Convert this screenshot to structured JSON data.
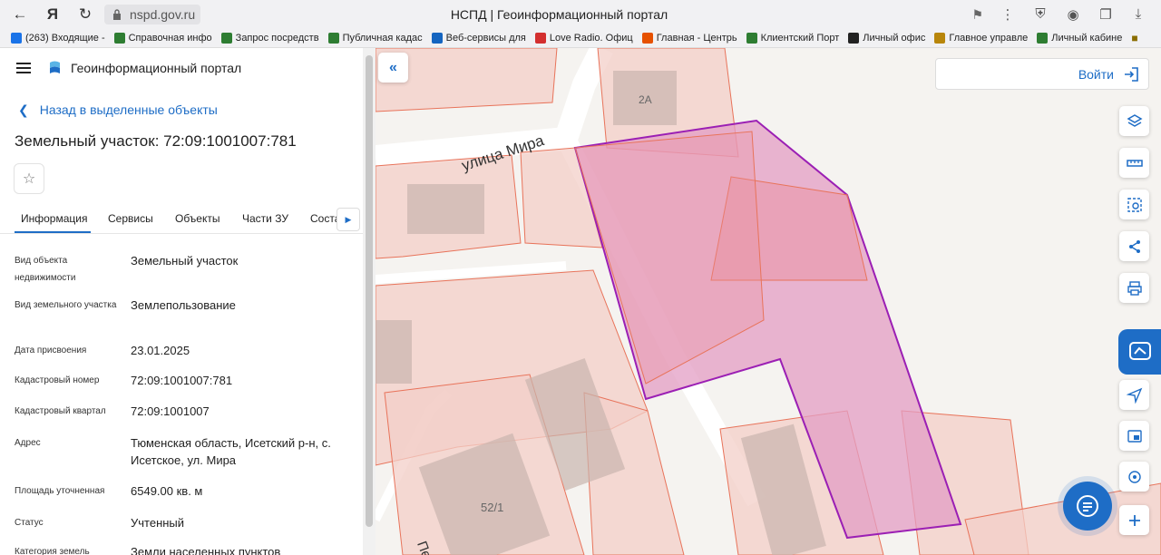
{
  "browser": {
    "url": "nspd.gov.ru",
    "tab_title": "НСПД | Геоинформационный портал",
    "bookmarks": [
      {
        "label": "(263) Входящие -",
        "icon": "mail-icon",
        "color": "#1a73e8"
      },
      {
        "label": "Справочная инфо",
        "icon": "doc-icon",
        "color": "#2e7d32"
      },
      {
        "label": "Запрос посредств",
        "icon": "doc-icon",
        "color": "#2e7d32"
      },
      {
        "label": "Публичная кадас",
        "icon": "gov-icon",
        "color": "#2e7d32"
      },
      {
        "label": "Веб-сервисы для",
        "icon": "grid-icon",
        "color": "#1565c0"
      },
      {
        "label": "Love Radio. Офиц",
        "icon": "radio-icon",
        "color": "#d32f2f"
      },
      {
        "label": "Главная - Центрь",
        "icon": "flame-icon",
        "color": "#e65100"
      },
      {
        "label": "Клиентский Порт",
        "icon": "globe-icon",
        "color": "#2e7d32"
      },
      {
        "label": "Личный офис",
        "icon": "nl-icon",
        "color": "#222222"
      },
      {
        "label": "Главное управле",
        "icon": "emblem-icon",
        "color": "#b8860b"
      },
      {
        "label": "Личный кабине",
        "icon": "gov-icon",
        "color": "#2e7d32"
      }
    ]
  },
  "panel": {
    "portal_title": "Геоинформационный портал",
    "back_label": "Назад в выделенные объекты",
    "object_title": "Земельный участок: 72:09:1001007:781",
    "tabs": [
      "Информация",
      "Сервисы",
      "Объекты",
      "Части ЗУ",
      "Соста"
    ],
    "fields": [
      {
        "key": "Вид объекта недвижимости",
        "value": "Земельный участок"
      },
      {
        "key": "Вид земельного участка",
        "value": "Землепользование"
      },
      {
        "key": "Дата присвоения",
        "value": "23.01.2025"
      },
      {
        "key": "Кадастровый номер",
        "value": "72:09:1001007:781"
      },
      {
        "key": "Кадастровый квартал",
        "value": "72:09:1001007"
      },
      {
        "key": "Адрес",
        "value": "Тюменская область, Исетский р-н, с. Исетское, ул. Мира"
      },
      {
        "key": "Площадь уточненная",
        "value": "6549.00 кв. м"
      },
      {
        "key": "Статус",
        "value": "Учтенный"
      },
      {
        "key": "Категория земель",
        "value": "Земли населенных пунктов"
      }
    ]
  },
  "map": {
    "login_label": "Войти",
    "labels": {
      "street": "улица Мира",
      "bldg_2a": "2А",
      "bldg_52": "52/1",
      "street2": "Пер"
    },
    "colors": {
      "accent": "#1e6dc6",
      "parcel_fill": "#f3cfc8",
      "parcel_stroke": "#e8735a",
      "selected_fill": "#e39ec4",
      "selected_stroke": "#9b1fb4"
    }
  }
}
